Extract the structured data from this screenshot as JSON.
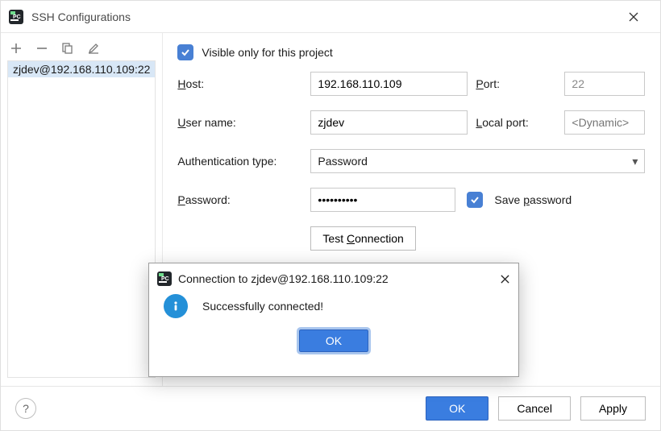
{
  "window": {
    "title": "SSH Configurations"
  },
  "toolbar": {
    "add_tip": "Add",
    "remove_tip": "Remove",
    "copy_tip": "Copy",
    "edit_tip": "Edit"
  },
  "list": {
    "items": [
      "zjdev@192.168.110.109:22"
    ]
  },
  "form": {
    "visible_only_label": "Visible only for this project",
    "visible_only_checked": true,
    "host_label": "Host:",
    "host_value": "192.168.110.109",
    "port_label": "Port:",
    "port_value": "22",
    "user_label": "User name:",
    "user_value": "zjdev",
    "local_port_label": "Local port:",
    "local_port_placeholder": "<Dynamic>",
    "auth_type_label": "Authentication type:",
    "auth_type_value": "Password",
    "password_label": "Password:",
    "password_masked": "••••••••••",
    "save_password_label": "Save password",
    "save_password_checked": true,
    "test_connection_label": "Test Connection"
  },
  "footer": {
    "ok_label": "OK",
    "cancel_label": "Cancel",
    "apply_label": "Apply",
    "help_tip": "Help"
  },
  "modal": {
    "title": "Connection to zjdev@192.168.110.109:22",
    "message": "Successfully connected!",
    "ok_label": "OK"
  }
}
